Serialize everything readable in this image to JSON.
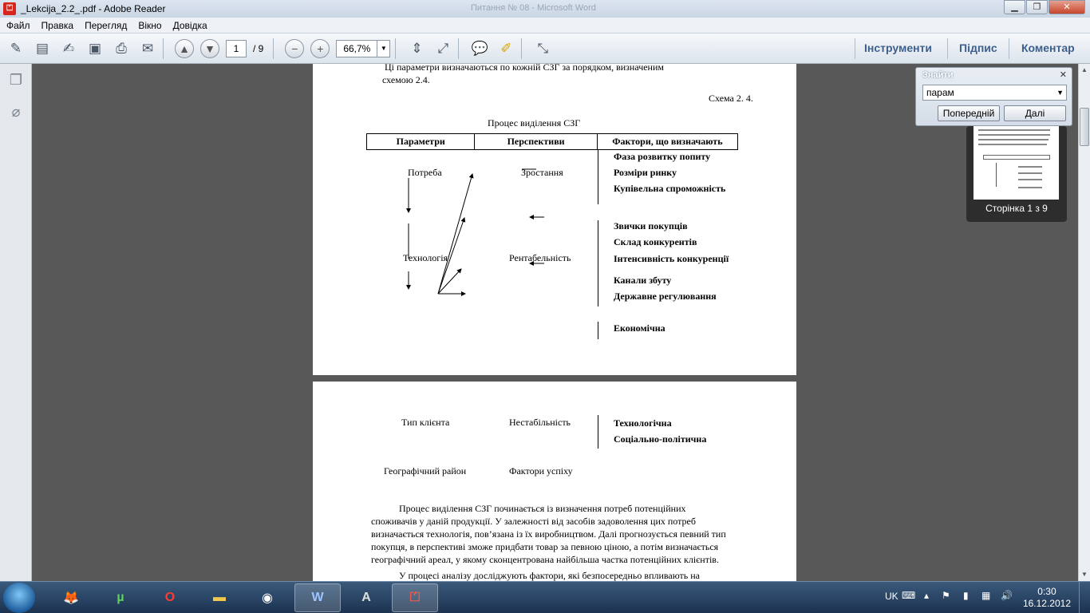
{
  "window": {
    "title": "_Lekcija_2.2_.pdf - Adobe Reader",
    "ghost_title": "Питання № 08 - Microsoft Word"
  },
  "menu": [
    "Файл",
    "Правка",
    "Перегляд",
    "Вікно",
    "Довідка"
  ],
  "toolbar": {
    "current_page": "1",
    "total_pages": "/ 9",
    "zoom": "66,7%",
    "tools_label": "Інструменти",
    "sign_label": "Підпис",
    "comment_label": "Коментар"
  },
  "find": {
    "label": "Знайти",
    "query": "парам",
    "prev_label": "Попередній",
    "next_label": "Далі"
  },
  "thumbnail": {
    "caption": "Сторінка 1 з 9"
  },
  "page1": {
    "intro_line1": "Ці параметри визначаються по кожній СЗГ  за порядком, визначеним",
    "intro_line2": "схемою 2.4.",
    "scheme_label": "Схема 2. 4.",
    "figure_title": "Процес виділення СЗГ",
    "table_headers": [
      "Параметри",
      "Перспективи",
      "Фактори, що визначають"
    ],
    "left_items": [
      "Потреба",
      "Технологія"
    ],
    "middle_items": [
      "Зростання",
      "Рентабельність"
    ],
    "factors_group1": [
      "Фаза розвитку попиту",
      "Розміри ринку",
      "Купівельна спроможність"
    ],
    "factors_group2": [
      "Звички покупців",
      "Склад конкурентів",
      "Інтенсивність конкуренції"
    ],
    "factors_group3": [
      "Канали збуту",
      "Державне регулювання"
    ],
    "factors_group4": [
      "Економічна"
    ]
  },
  "page2": {
    "client_type": "Тип клієнта",
    "instability": "Нестабільність",
    "factors_group5": [
      "Технологічна",
      "Соціально-політична"
    ],
    "geo_region": "Географічний район",
    "success_factors": "Фактори успіху",
    "para_lines": [
      "Процес  виділення  СЗГ  починається  із  визначення  потреб  потенційних",
      "споживачів у даній продукції. У залежності від засобів   задоволення   цих   потреб",
      "визначається    технологія, пов’язана із їх виробництвом. Далі прогнозується певний тип",
      "покупця, в перспективі зможе придбати товар за певною ціною, а потім визначається",
      "географічний ареал, у якому сконцентрована найбільша частка потенційних клієнтів.",
      "У  процесі  аналізу  досліджують  фактори,  які  безпосередньо  впливають  на"
    ]
  },
  "taskbar": {
    "lang": "UK",
    "time": "0:30",
    "date": "16.12.2012"
  }
}
